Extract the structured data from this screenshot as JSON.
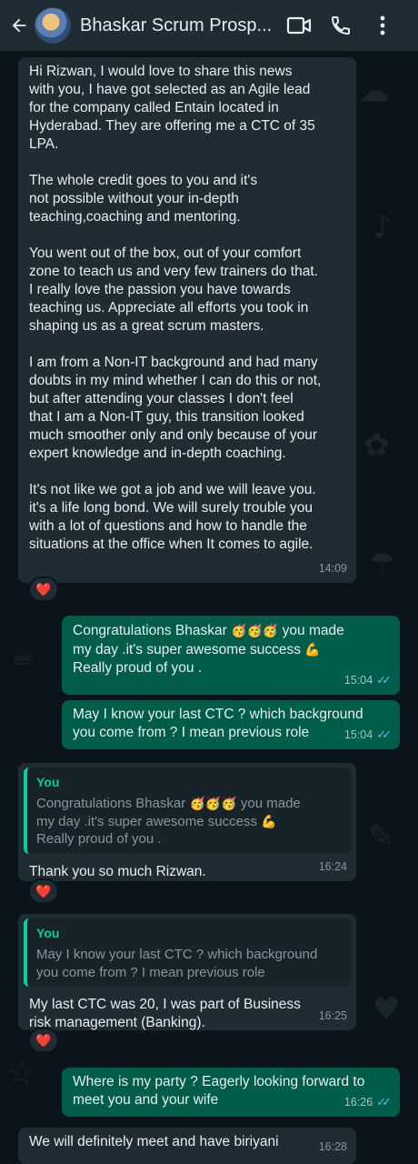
{
  "header": {
    "title": "Bhaskar Scrum Prosp...",
    "icons": [
      "back-arrow-icon",
      "video-call-icon",
      "phone-icon",
      "more-vert-icon"
    ]
  },
  "colors": {
    "header_bg": "#1f2c34",
    "incoming_bubble": "#1f2c34",
    "outgoing_bubble": "#005c4b",
    "quote_accent": "#06cf9c",
    "read_ticks": "#53bdeb"
  },
  "messages": [
    {
      "dir": "in",
      "text": "Hi Rizwan, I would love to share this news\nwith you, I have got selected as an Agile lead\nfor the company called Entain located in\nHyderabad. They are offering me a CTC of 35\nLPA.\n\nThe whole credit goes to you and it's\nnot possible without your in-depth\nteaching,coaching and mentoring.\n\nYou went out of the box, out of your comfort\nzone to teach us and very few trainers do that.\nI really love the passion you have towards\nteaching us. Appreciate all efforts you took in\nshaping us as a great scrum masters.\n\nI am from a Non-IT background and had many\ndoubts in my mind whether I can do this or not,\nbut after attending your classes I don't feel\nthat I am a Non-IT guy, this transition looked\nmuch smoother only and only because of your\nexpert knowledge and in-depth coaching.\n\nIt's not like we got a job and we will leave you.\nit's a life long bond. We will surely trouble you\nwith a lot of questions and how to handle the\nsituations at the office when It comes to agile.",
      "time": "14:09",
      "reaction": "❤️"
    },
    {
      "dir": "out",
      "text_a": "Congratulations Bhaskar ",
      "emoji_a": "🥳🥳🥳",
      "text_b": " you made\nmy day .it's super awesome success ",
      "emoji_b": "💪",
      "text_c": "\nReally proud of you .",
      "time": "15:04",
      "status": "read"
    },
    {
      "dir": "out",
      "text": "May I know your last CTC ? which background\nyou come from ? I mean previous role",
      "time": "15:04",
      "status": "read"
    },
    {
      "dir": "in",
      "quote_author": "You",
      "quote_text_a": "Congratulations Bhaskar ",
      "quote_emoji_a": "🥳🥳🥳",
      "quote_text_b": " you made\nmy day .it's super awesome success ",
      "quote_emoji_b": "💪",
      "quote_text_c": "\nReally proud of you .",
      "text": "Thank you so much Rizwan.",
      "time": "16:24",
      "reaction": "❤️"
    },
    {
      "dir": "in",
      "quote_author": "You",
      "quote_text": "May I know your last CTC ? which background\nyou come from ? I mean previous role",
      "text": "My last CTC was 20, I was part of Business\nrisk management (Banking).",
      "time": "16:25",
      "reaction": "❤️"
    },
    {
      "dir": "out",
      "text": "Where is my party ? Eagerly looking forward to\nmeet you and your wife",
      "time": "16:26",
      "status": "read"
    },
    {
      "dir": "in",
      "text": "We will definitely meet and have biriyani",
      "time": "16:28"
    }
  ]
}
